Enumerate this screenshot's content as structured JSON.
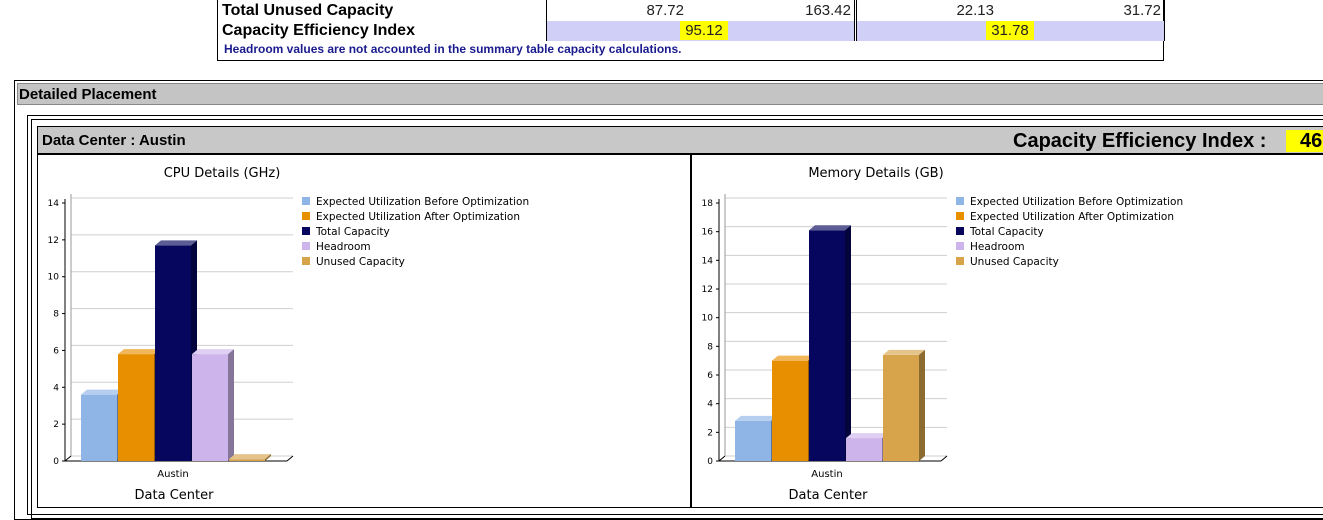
{
  "summary": {
    "rows": [
      {
        "label": "Total Unused Capacity",
        "values": [
          "87.72",
          "163.42",
          "22.13",
          "31.72"
        ]
      },
      {
        "label": "Capacity Efficiency Index",
        "values": [
          "95.12",
          "31.78"
        ]
      }
    ],
    "note": "Headroom values are not accounted in the summary table capacity calculations."
  },
  "detailed_placement": {
    "title": "Detailed Placement",
    "data_center_label": "Data Center : Austin",
    "cei_label": "Capacity Efficiency Index :",
    "cei_value": "46"
  },
  "chart_data": [
    {
      "type": "bar",
      "title": "CPU Details (GHz)",
      "xlabel": "Data Center",
      "ylabel": "",
      "categories": [
        "Austin"
      ],
      "ylim": [
        0,
        14
      ],
      "yticks": [
        0,
        2,
        4,
        6,
        8,
        10,
        12,
        14
      ],
      "grid": true,
      "legend_position": "right",
      "series": [
        {
          "name": "Expected Utilization Before Optimization",
          "values": [
            3.6
          ],
          "color": "#8fb4e6"
        },
        {
          "name": "Expected Utilization After Optimization",
          "values": [
            5.8
          ],
          "color": "#e88f00"
        },
        {
          "name": "Total Capacity",
          "values": [
            11.7
          ],
          "color": "#06065e"
        },
        {
          "name": "Headroom",
          "values": [
            5.8
          ],
          "color": "#cdb5ec"
        },
        {
          "name": "Unused Capacity",
          "values": [
            0.1
          ],
          "color": "#d7a44c"
        }
      ]
    },
    {
      "type": "bar",
      "title": "Memory Details (GB)",
      "xlabel": "Data Center",
      "ylabel": "",
      "categories": [
        "Austin"
      ],
      "ylim": [
        0,
        18
      ],
      "yticks": [
        0,
        2,
        4,
        6,
        8,
        10,
        12,
        14,
        16,
        18
      ],
      "grid": true,
      "legend_position": "right",
      "series": [
        {
          "name": "Expected Utilization Before Optimization",
          "values": [
            2.8
          ],
          "color": "#8fb4e6"
        },
        {
          "name": "Expected Utilization After Optimization",
          "values": [
            7.0
          ],
          "color": "#e88f00"
        },
        {
          "name": "Total Capacity",
          "values": [
            16.1
          ],
          "color": "#06065e"
        },
        {
          "name": "Headroom",
          "values": [
            1.6
          ],
          "color": "#cdb5ec"
        },
        {
          "name": "Unused Capacity",
          "values": [
            7.4
          ],
          "color": "#d7a44c"
        }
      ]
    }
  ]
}
